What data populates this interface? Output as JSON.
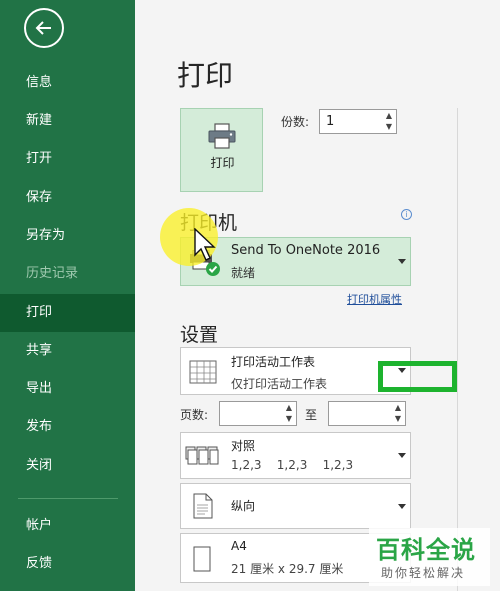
{
  "sidebar": {
    "items": [
      {
        "label": "信息"
      },
      {
        "label": "新建"
      },
      {
        "label": "打开"
      },
      {
        "label": "保存"
      },
      {
        "label": "另存为"
      },
      {
        "label": "历史记录"
      },
      {
        "label": "打印"
      },
      {
        "label": "共享"
      },
      {
        "label": "导出"
      },
      {
        "label": "发布"
      },
      {
        "label": "关闭"
      },
      {
        "label": "帐户"
      },
      {
        "label": "反馈"
      }
    ],
    "active_item": "打印",
    "disabled_item": "历史记录"
  },
  "main": {
    "title": "打印",
    "print_button_label": "打印",
    "copies_label": "份数:",
    "copies_value": "1",
    "printer_section_title": "打印机",
    "printer": {
      "name": "Send To OneNote 2016",
      "status": "就绪"
    },
    "printer_properties_link": "打印机属性",
    "settings_section_title": "设置",
    "print_what": {
      "title": "打印活动工作表",
      "subtitle": "仅打印活动工作表"
    },
    "pages_label": "页数:",
    "to_label": "至",
    "collation": {
      "title": "对照",
      "subtitle": "1,2,3    1,2,3    1,2,3"
    },
    "orientation": {
      "title": "纵向"
    },
    "paper_size": {
      "title": "A4",
      "subtitle": "21 厘米 x 29.7 厘米"
    }
  },
  "watermark": {
    "line1": "百科全说",
    "line2": "助你轻松解决"
  },
  "colors": {
    "sidebar_bg": "#217346",
    "sidebar_active": "#0f5a2f",
    "selected_bg": "#d4ecd9",
    "highlight_box": "#1db32e",
    "cursor_highlight": "#faf028",
    "link": "#1f4e9a"
  },
  "icons": [
    "back-arrow-icon",
    "printer-icon",
    "info-icon",
    "printer-status-icon",
    "sheet-grid-icon",
    "collate-icon",
    "portrait-page-icon",
    "paper-icon",
    "chevron-down-icon",
    "mouse-cursor-icon"
  ]
}
